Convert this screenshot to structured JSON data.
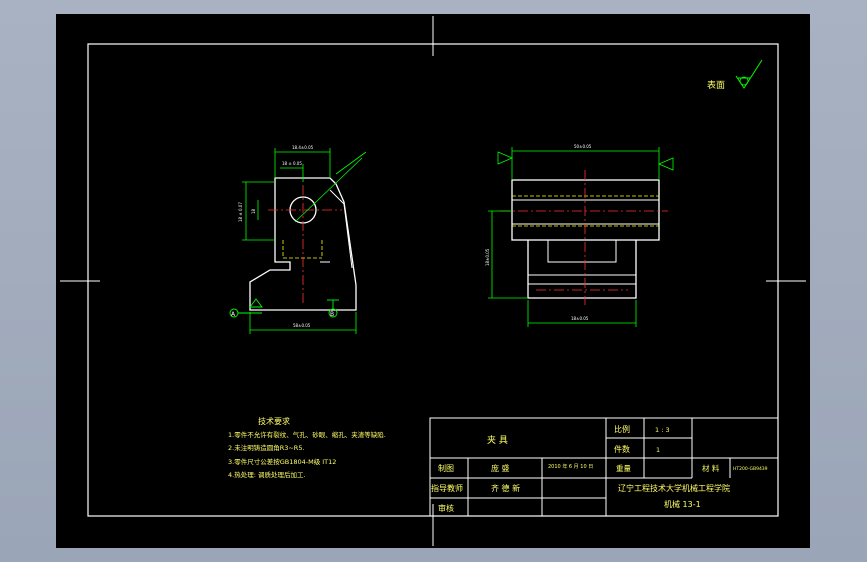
{
  "surface_text": "表面",
  "left_view": {
    "dim_top_outer": "18.4±0.05",
    "dim_top_inner": "18 ± 0.05",
    "dim_vert_outer": "18 ± 0.07",
    "dim_vert_inner": "18",
    "dim_bottom": "58±0.05",
    "datum_a": "A",
    "datum_b": "B"
  },
  "right_view": {
    "dim_top": "50±0.05",
    "dim_height": "18±0.05",
    "dim_bottom": "18±0.05"
  },
  "tech_req": {
    "title": "技术要求",
    "lines": [
      "1.零件不允许有裂纹、气孔、砂眼、缩孔、夹渣等缺陷.",
      "2.未注明铸造圆角R3~R5.",
      "3.零件尺寸公差按GB1804-M级 IT12",
      "4.热处理: 调质处理后加工."
    ]
  },
  "title_block": {
    "part_name": "夹  具",
    "scale_label": "比例",
    "scale_value": "1 : 3",
    "qty_label": "件数",
    "qty_value": "1",
    "drawn_label": "制图",
    "drawn_name": "庞 盛",
    "drawn_date": "2010 年 6 月 10 日",
    "weight_label": "重量",
    "material_label": "材 料",
    "material_value": "HT200-GB9439",
    "advisor_label": "指导教师",
    "advisor_name": "齐 德 新",
    "review_label": "审核",
    "school": "辽宁工程技术大学机械工程学院",
    "class": "机械 13-1"
  }
}
